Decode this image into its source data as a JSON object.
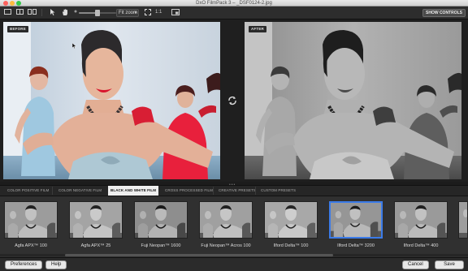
{
  "window": {
    "title": "DxO FilmPack 3 – _DSF0124-2.jpg"
  },
  "toolbar": {
    "zoom_value": "Fit zoom",
    "zoom_slider_value": 0.5,
    "one_to_one": "1:1",
    "show_controls": "SHOW CONTROLS"
  },
  "panes": {
    "before_label": "BEFORE",
    "after_label": "AFTER"
  },
  "categories": {
    "tabs": [
      "COLOR POSITIVE FILM",
      "COLOR NEGATIVE FILM",
      "BLACK AND WHITE FILM",
      "CROSS PROCESSED FILM",
      "CREATIVE PRESETS",
      "CUSTOM PRESETS"
    ],
    "active": "BLACK AND WHITE FILM"
  },
  "films": [
    {
      "label": "Agfa APX™ 100",
      "selected": false
    },
    {
      "label": "Agfa APX™ 25",
      "selected": false
    },
    {
      "label": "Fuji Neopan™ 1600",
      "selected": false
    },
    {
      "label": "Fuji Neopan™ Acros 100",
      "selected": false
    },
    {
      "label": "Ilford Delta™ 100",
      "selected": false
    },
    {
      "label": "Ilford Delta™ 3200",
      "selected": true
    },
    {
      "label": "Ilford Delta™ 400",
      "selected": false
    }
  ],
  "buttons": {
    "preferences": "Preferences",
    "help": "Help",
    "cancel": "Cancel",
    "save": "Save"
  },
  "colors": {
    "selection": "#3b7be8",
    "lips": "#d8142c",
    "dress_red": "#e8203c"
  }
}
